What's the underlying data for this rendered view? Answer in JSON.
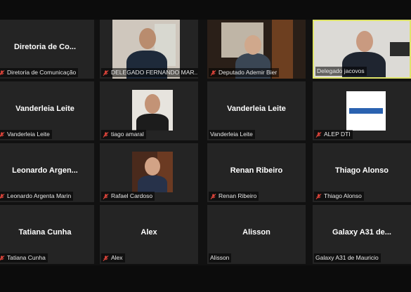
{
  "tiles": [
    {
      "center": "Diretoria de Co...",
      "label": "Diretoria de Comunicação",
      "muted": true,
      "video": false
    },
    {
      "center": "",
      "label": "DELEGADO FERNANDO MAR...",
      "muted": true,
      "video": true
    },
    {
      "center": "",
      "label": "Deputado Ademir Bier",
      "muted": true,
      "video": true
    },
    {
      "center": "",
      "label": "Delegado jacovos",
      "muted": false,
      "video": true,
      "active": true
    },
    {
      "center": "Vanderleia Leite",
      "label": "Vanderleia Leite",
      "muted": true,
      "video": false
    },
    {
      "center": "",
      "label": "tiago amaral",
      "muted": true,
      "video": true
    },
    {
      "center": "Vanderleia Leite",
      "label": "Vanderleia Leite",
      "muted": false,
      "video": false
    },
    {
      "center": "",
      "label": "ALEP DTI",
      "muted": true,
      "video": true
    },
    {
      "center": "Leonardo Argen...",
      "label": "Leonardo Argenta Marin",
      "muted": true,
      "video": false
    },
    {
      "center": "",
      "label": "Rafael Cardoso",
      "muted": true,
      "video": true
    },
    {
      "center": "Renan Ribeiro",
      "label": "Renan Ribeiro",
      "muted": true,
      "video": false
    },
    {
      "center": "Thiago Alonso",
      "label": "Thiago Alonso",
      "muted": true,
      "video": false
    },
    {
      "center": "Tatiana Cunha",
      "label": "Tatiana Cunha",
      "muted": true,
      "video": false
    },
    {
      "center": "Alex",
      "label": "Alex",
      "muted": true,
      "video": false
    },
    {
      "center": "Alisson",
      "label": "Alisson",
      "muted": false,
      "video": false
    },
    {
      "center": "Galaxy A31 de...",
      "label": "Galaxy A31 de Mauricio",
      "muted": false,
      "video": false
    }
  ],
  "colors": {
    "mute_icon": "#e0453b",
    "active_border": "#dfe46a",
    "tile_bg": "#242424"
  }
}
